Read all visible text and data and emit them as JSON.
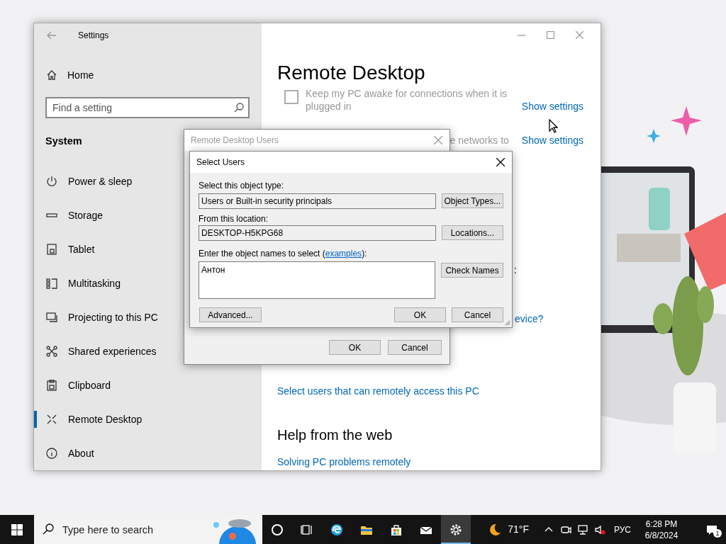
{
  "settings_window": {
    "title": "Settings",
    "home": "Home",
    "search": {
      "placeholder": "Find a setting"
    },
    "section": "System",
    "nav_items": [
      {
        "label": "Power & sleep",
        "selected": false
      },
      {
        "label": "Storage",
        "selected": false
      },
      {
        "label": "Tablet",
        "selected": false
      },
      {
        "label": "Multitasking",
        "selected": false
      },
      {
        "label": "Projecting to this PC",
        "selected": false
      },
      {
        "label": "Shared experiences",
        "selected": false
      },
      {
        "label": "Clipboard",
        "selected": false
      },
      {
        "label": "Remote Desktop",
        "selected": true
      },
      {
        "label": "About",
        "selected": false
      }
    ],
    "content": {
      "heading": "Remote Desktop",
      "keep_awake": {
        "label": "Keep my PC awake for connections when it is plugged in",
        "checked": false,
        "disabled": true
      },
      "show_settings_links": [
        "Show settings",
        "Show settings"
      ],
      "partial_text_1": "e networks to",
      "partial_text_2": ":",
      "partial_text_3": "evice?",
      "user_accounts_link": "Select users that can remotely access this PC",
      "help_heading": "Help from the web",
      "help_link": "Solving PC problems remotely"
    }
  },
  "remote_desktop_users_dialog": {
    "title": "Remote Desktop Users",
    "active": false,
    "buttons": [
      "OK",
      "Cancel"
    ]
  },
  "select_users_dialog": {
    "title": "Select Users",
    "active": true,
    "object_type_label": "Select this object type:",
    "object_type_value": "Users or Built-in security principals",
    "object_types_button": "Object Types...",
    "location_label": "From this location:",
    "location_value": "DESKTOP-H5KPG68",
    "locations_button": "Locations...",
    "names_label_before": "Enter the object names to select (",
    "names_label_link": "examples",
    "names_label_after": "):",
    "names_value": "Антон",
    "check_names_button": "Check Names",
    "advanced_button": "Advanced...",
    "buttons": [
      "OK",
      "Cancel"
    ]
  },
  "taskbar": {
    "search": {
      "placeholder": "Type here to search"
    },
    "apps": [
      {
        "selected": false
      },
      {
        "selected": false
      },
      {
        "selected": false
      },
      {
        "selected": false
      },
      {
        "selected": false
      },
      {
        "selected": false
      },
      {
        "selected": true
      }
    ],
    "weather": "71°F",
    "language": "РУС",
    "time": "6:28 PM",
    "date": "6/8/2024",
    "notifications": "1"
  }
}
